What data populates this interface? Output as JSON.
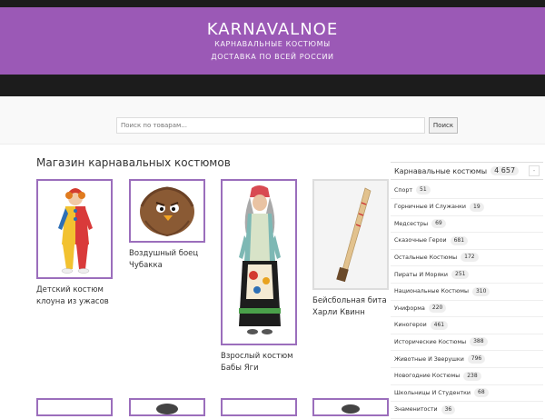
{
  "header": {
    "title": "KARNAVALNOE",
    "tagline1": "КАРНАВАЛЬНЫЕ КОСТЮМЫ",
    "tagline2": "ДОСТАВКА ПО ВСЕЙ РОССИИ"
  },
  "search": {
    "placeholder": "Поиск по товарам...",
    "button_label": "Поиск"
  },
  "shop": {
    "title": "Магазин карнавальных костюмов",
    "products": [
      {
        "name": "Детский костюм клоуна из ужасов"
      },
      {
        "name": "Воздушный боец Чубакка"
      },
      {
        "name": "Взрослый костюм Бабы Яги"
      },
      {
        "name": "Бейсбольная бита Харли Квинн"
      }
    ]
  },
  "sidebar": {
    "header_label": "Карнавальные костюмы",
    "header_count": "4 657",
    "categories": [
      {
        "label": "Спорт",
        "count": "51"
      },
      {
        "label": "Горничные И Служанки",
        "count": "19"
      },
      {
        "label": "Медсестры",
        "count": "69"
      },
      {
        "label": "Сказочные Герои",
        "count": "681"
      },
      {
        "label": "Остальные Костюмы",
        "count": "172"
      },
      {
        "label": "Пираты И Моряки",
        "count": "251"
      },
      {
        "label": "Национальные Костюмы",
        "count": "310"
      },
      {
        "label": "Униформа",
        "count": "220"
      },
      {
        "label": "Киногерои",
        "count": "461"
      },
      {
        "label": "Исторические Костюмы",
        "count": "388"
      },
      {
        "label": "Животные И Зверушки",
        "count": "796"
      },
      {
        "label": "Новогодние Костюмы",
        "count": "238"
      },
      {
        "label": "Школьницы И Студентки",
        "count": "68"
      },
      {
        "label": "Знаменитости",
        "count": "36"
      }
    ]
  }
}
